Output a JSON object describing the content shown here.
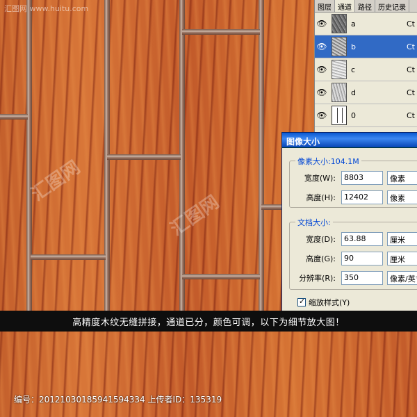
{
  "watermark": {
    "top_left": "汇图网 www.huitu.com",
    "center": "汇图网"
  },
  "channels_panel": {
    "tabs": [
      "图层",
      "通道",
      "路径",
      "历史记录"
    ],
    "active_tab": "通道",
    "channels": [
      {
        "name": "a",
        "shortcut": "Ct"
      },
      {
        "name": "b",
        "shortcut": "Ct"
      },
      {
        "name": "c",
        "shortcut": "Ct"
      },
      {
        "name": "d",
        "shortcut": "Ct"
      },
      {
        "name": "0",
        "shortcut": "Ct"
      }
    ],
    "selected_index": 1
  },
  "image_size_dialog": {
    "title": "图像大小",
    "pixel_dimensions": {
      "legend": "像素大小:104.1M",
      "width_label": "宽度(W):",
      "width_value": "8803",
      "width_unit": "像素",
      "height_label": "高度(H):",
      "height_value": "12402",
      "height_unit": "像素"
    },
    "document_size": {
      "legend": "文档大小:",
      "width_label": "宽度(D):",
      "width_value": "63.88",
      "width_unit": "厘米",
      "height_label": "高度(G):",
      "height_value": "90",
      "height_unit": "厘米",
      "resolution_label": "分辨率(R):",
      "resolution_value": "350",
      "resolution_unit": "像素/英寸"
    },
    "scale_styles_label": "缩放样式(Y)",
    "scale_styles_checked": true
  },
  "caption": "高精度木纹无缝拼接，通道已分，颜色可调，以下为细节放大图！",
  "footer": "编号：20121030185941594334 上传者ID：135319"
}
